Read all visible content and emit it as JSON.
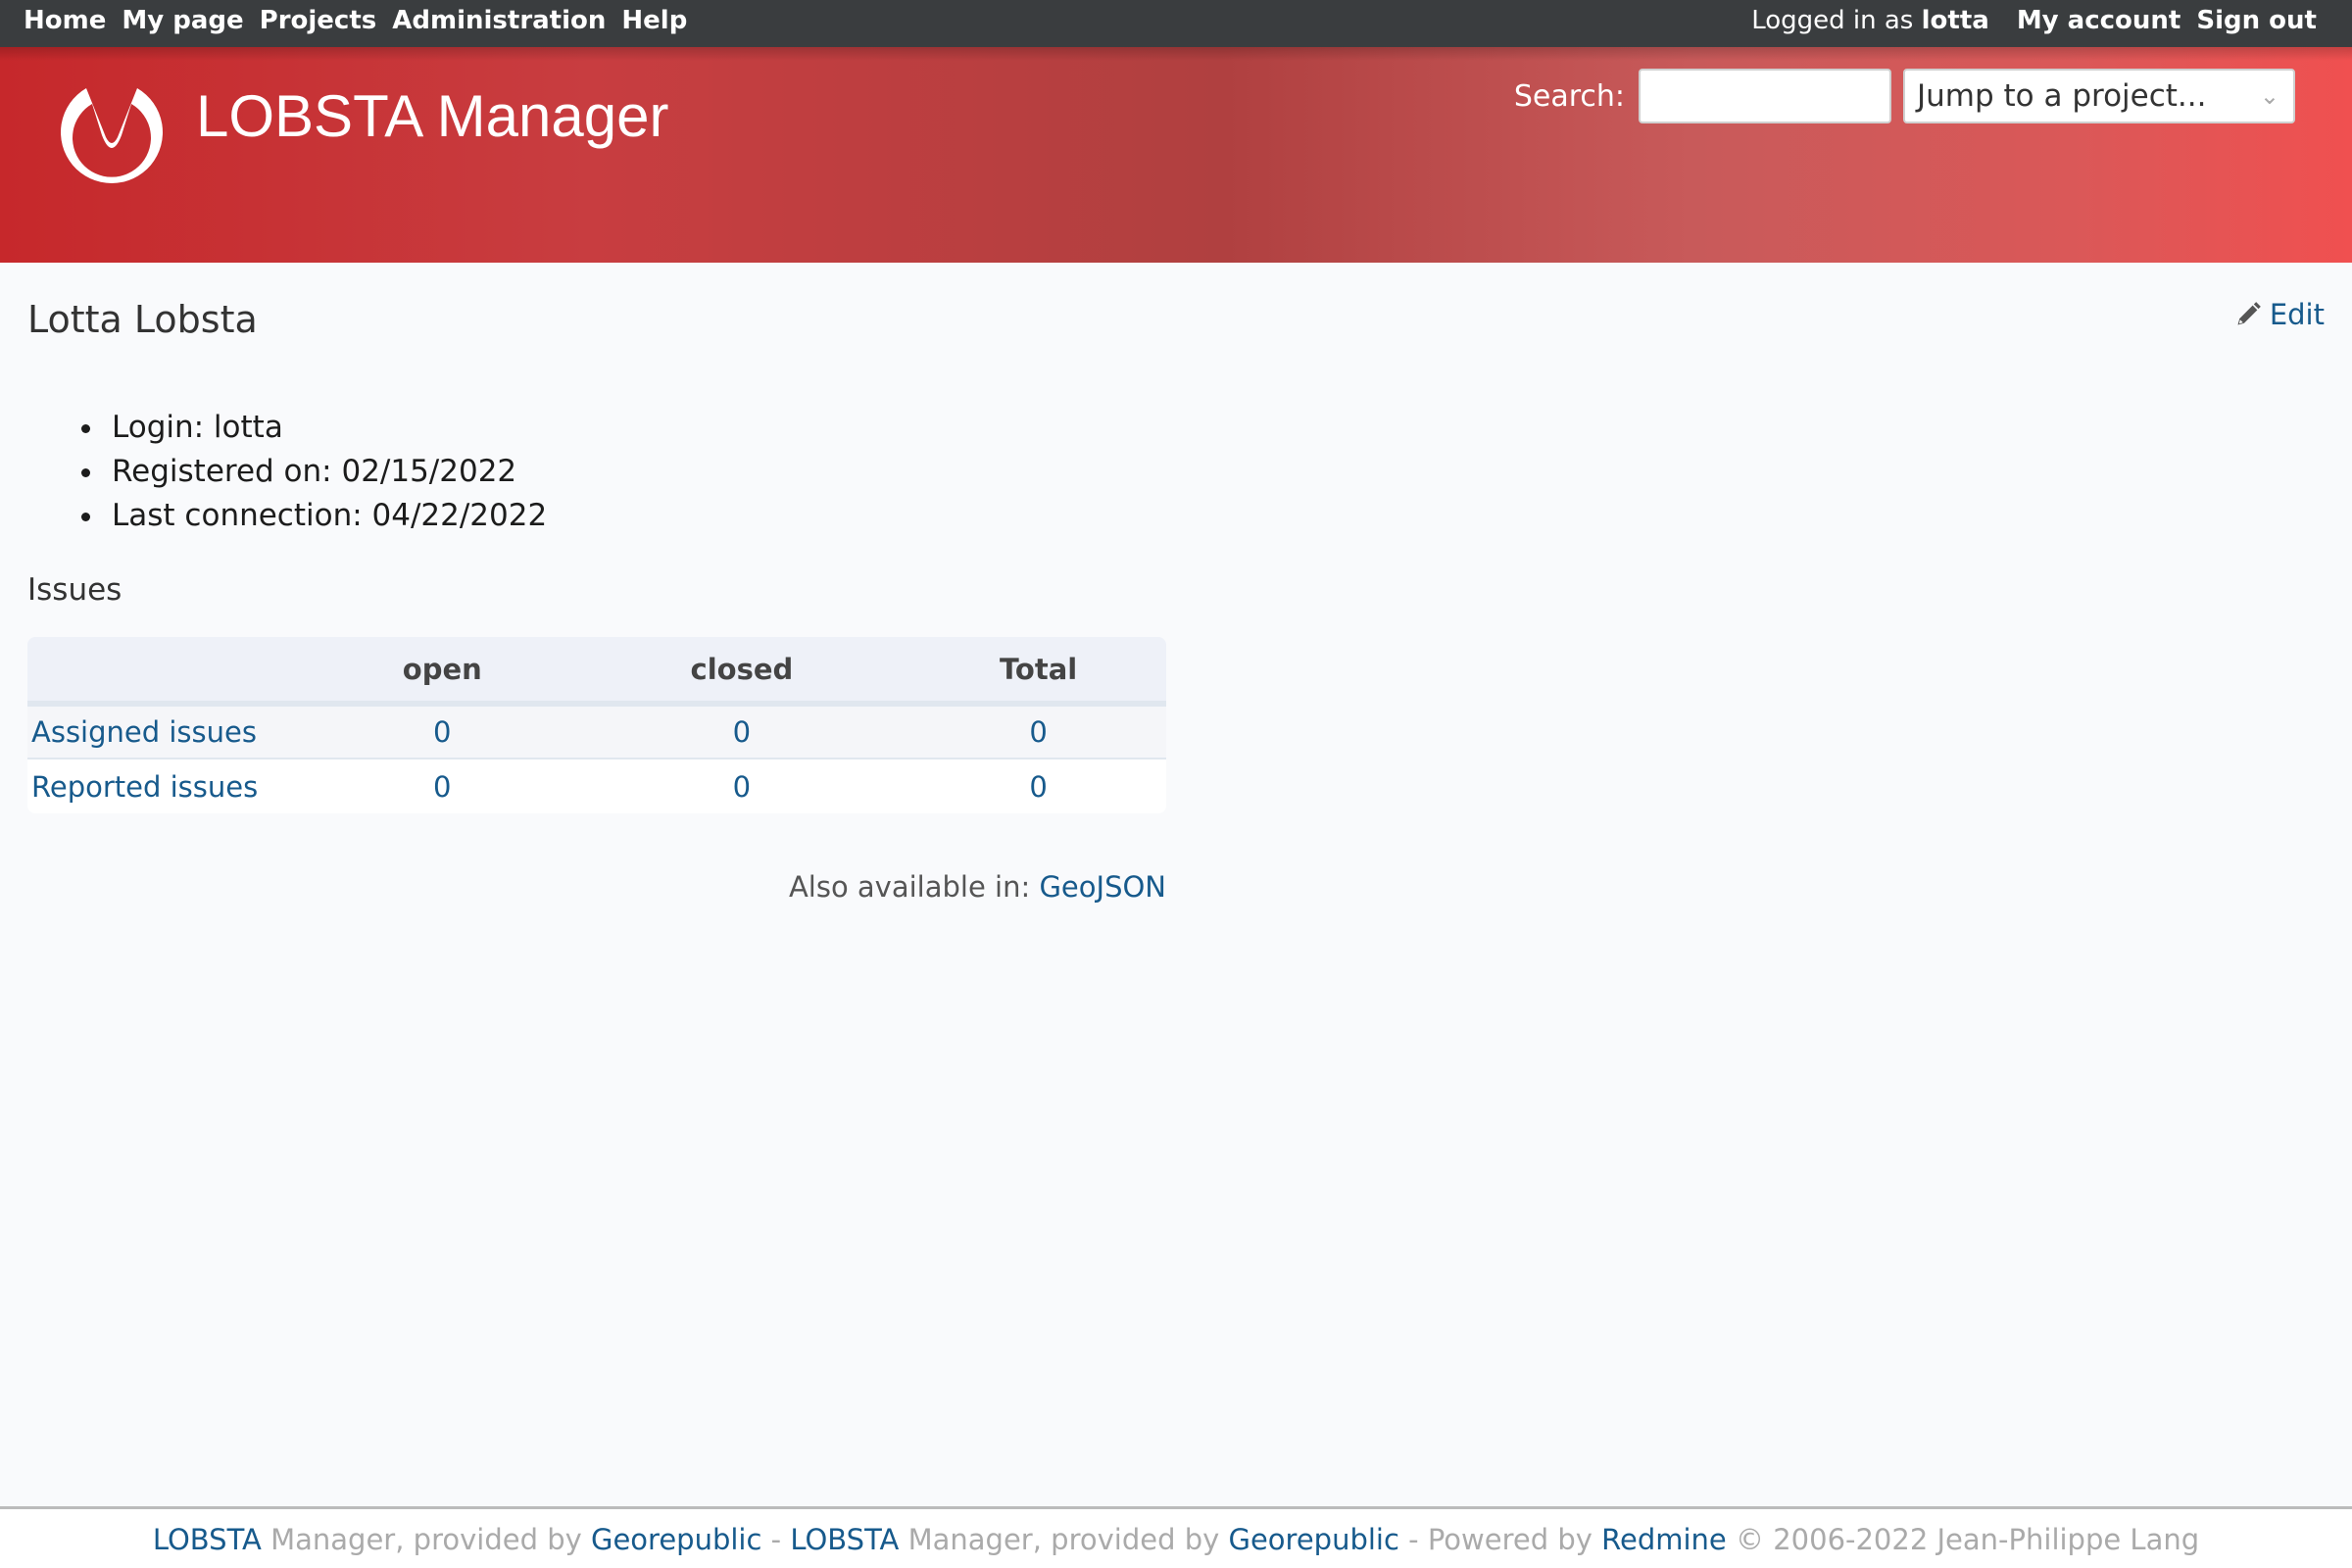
{
  "top_menu": {
    "left_links": [
      "Home",
      "My page",
      "Projects",
      "Administration",
      "Help"
    ],
    "logged_in_prefix": "Logged in as",
    "logged_in_user": "lotta",
    "right_links": [
      "My account",
      "Sign out"
    ]
  },
  "header": {
    "logo_icon": "lobsta-logo-icon",
    "title": "LOBSTA Manager",
    "search_label": "Search:",
    "search_value": "",
    "search_placeholder": "",
    "project_jump_label": "Jump to a project...",
    "project_jump_chevron": "⌄"
  },
  "main": {
    "page_title": "Lotta Lobsta",
    "edit_label": "Edit",
    "edit_icon": "pencil-icon",
    "user_info": [
      "Login: lotta",
      "Registered on: 02/15/2022",
      "Last connection: 04/22/2022"
    ],
    "issues_heading": "Issues",
    "issues_table": {
      "headers": [
        "",
        "open",
        "closed",
        "Total"
      ],
      "rows": [
        {
          "label": "Assigned issues",
          "open": "0",
          "closed": "0",
          "total": "0"
        },
        {
          "label": "Reported issues",
          "open": "0",
          "closed": "0",
          "total": "0"
        }
      ]
    },
    "other_formats_label": "Also available in:",
    "other_formats_link": "GeoJSON"
  },
  "footer": {
    "parts": [
      {
        "text": "LOBSTA",
        "link": true
      },
      {
        "text": " Manager, provided by ",
        "link": false
      },
      {
        "text": "Georepublic",
        "link": true
      },
      {
        "text": " - ",
        "link": false
      },
      {
        "text": "LOBSTA",
        "link": true
      },
      {
        "text": " Manager, provided by ",
        "link": false
      },
      {
        "text": "Georepublic",
        "link": true
      },
      {
        "text": " - Powered by ",
        "link": false
      },
      {
        "text": "Redmine",
        "link": true
      },
      {
        "text": " © 2006-2022 Jean-Philippe Lang",
        "link": false
      }
    ]
  },
  "colors": {
    "top_bar": "#3a3d3f",
    "header_red": "#c6282b",
    "link": "#175a8c",
    "background": "#f9fafc"
  }
}
